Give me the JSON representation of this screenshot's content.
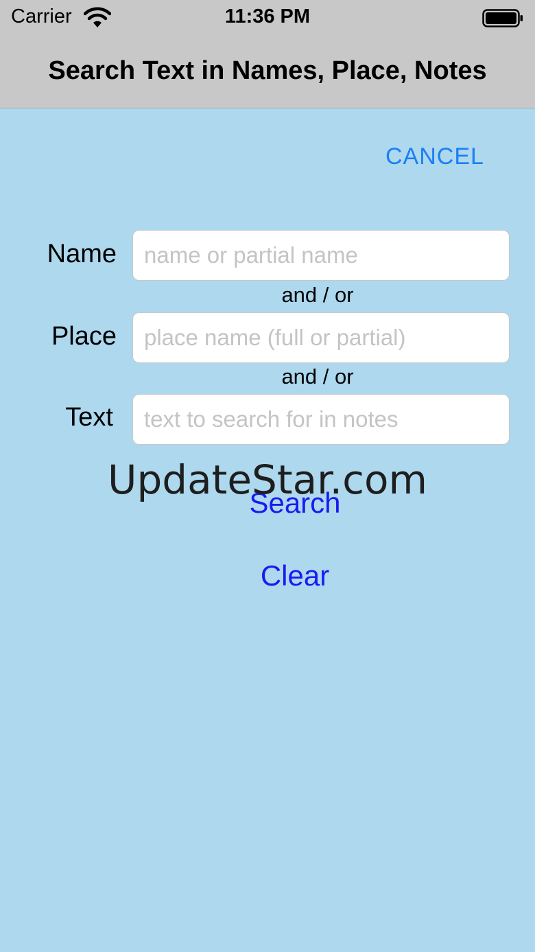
{
  "status_bar": {
    "carrier": "Carrier",
    "time": "11:36 PM",
    "wifi_icon": "wifi-icon",
    "battery_icon": "battery-full-icon"
  },
  "nav": {
    "title": "Search Text in Names, Place, Notes"
  },
  "cancel_label": "CANCEL",
  "form": {
    "name": {
      "label": "Name",
      "value": "",
      "placeholder": "name or partial name"
    },
    "and_or_1": "and / or",
    "place": {
      "label": "Place",
      "value": "",
      "placeholder": "place name (full or partial)"
    },
    "and_or_2": "and / or",
    "text": {
      "label": "Text",
      "value": "",
      "placeholder": "text to search for in notes"
    }
  },
  "actions": {
    "search_label": "Search",
    "clear_label": "Clear"
  },
  "watermark": "UpdateStar.com",
  "colors": {
    "background": "#add8ee",
    "header": "#c8c8c8",
    "cancel": "#1a7ff5",
    "action": "#1a1af0"
  }
}
